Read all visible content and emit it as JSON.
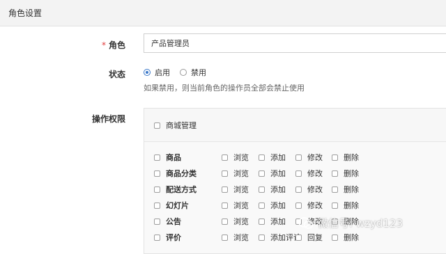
{
  "header": {
    "title": "角色设置"
  },
  "form": {
    "role_label": "角色",
    "role_required_mark": "*",
    "role_value": "产品管理员",
    "status_label": "状态",
    "status_options": [
      {
        "label": "启用",
        "checked": true
      },
      {
        "label": "禁用",
        "checked": false
      }
    ],
    "status_hint": "如果禁用，则当前角色的操作员全部会禁止使用",
    "perm_label": "操作权限"
  },
  "permissions": {
    "group": "商城管理",
    "rows": [
      {
        "name": "商品",
        "actions": [
          "浏览",
          "添加",
          "修改",
          "删除"
        ]
      },
      {
        "name": "商品分类",
        "actions": [
          "浏览",
          "添加",
          "修改",
          "删除"
        ]
      },
      {
        "name": "配送方式",
        "actions": [
          "浏览",
          "添加",
          "修改",
          "删除"
        ]
      },
      {
        "name": "幻灯片",
        "actions": [
          "浏览",
          "添加",
          "修改",
          "删除"
        ]
      },
      {
        "name": "公告",
        "actions": [
          "浏览",
          "添加",
          "修改",
          "删除"
        ]
      },
      {
        "name": "评价",
        "actions": [
          "浏览",
          "添加评论",
          "回复",
          "删除"
        ]
      }
    ]
  },
  "watermark": {
    "text": "微信号: wzyd123",
    "icon": "wechat-icon"
  },
  "colors": {
    "accent": "#3a78c9",
    "required": "#e03a3a",
    "header_bg": "#f3f3f3"
  }
}
